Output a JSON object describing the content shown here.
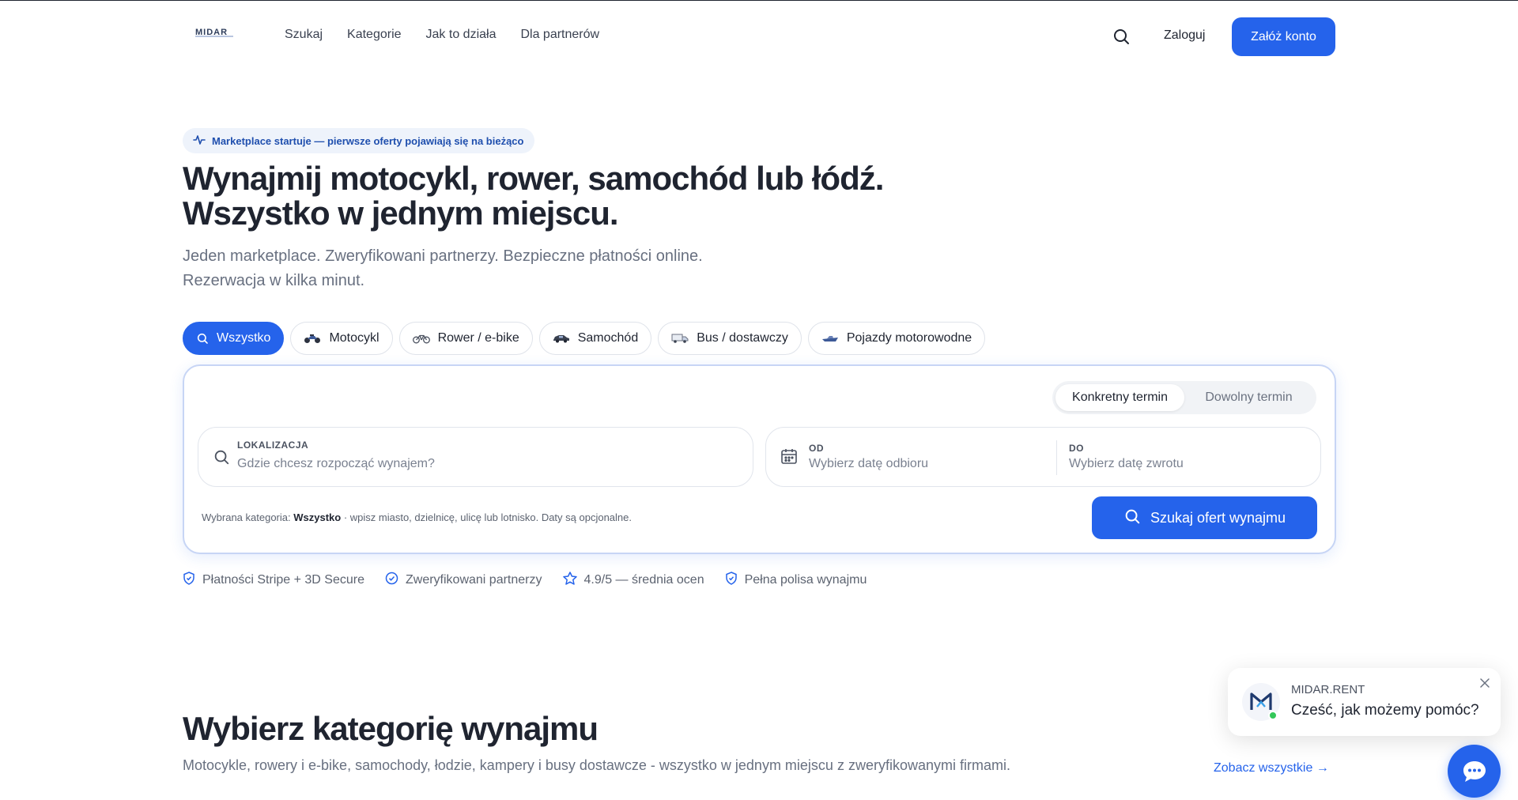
{
  "nav": {
    "logo_text": "MIDAR",
    "links": [
      "Szukaj",
      "Kategorie",
      "Jak to działa",
      "Dla partnerów"
    ],
    "login_label": "Zaloguj",
    "signup_label": "Załóż konto"
  },
  "hero": {
    "badge_text": "Marketplace startuje — pierwsze oferty pojawiają się na bieżąco",
    "title_line1": "Wynajmij motocykl, rower, samochód lub łódź.",
    "title_line2": "Wszystko w jednym miejscu.",
    "subtitle_line1": "Jeden marketplace. Zweryfikowani partnerzy. Bezpieczne płatności online.",
    "subtitle_line2": "Rezerwacja w kilka minut."
  },
  "categories": [
    {
      "label": "Wszystko",
      "icon": "search-icon",
      "active": true
    },
    {
      "label": "Motocykl",
      "icon": "motorcycle-icon",
      "active": false
    },
    {
      "label": "Rower / e-bike",
      "icon": "bicycle-icon",
      "active": false
    },
    {
      "label": "Samochód",
      "icon": "car-icon",
      "active": false
    },
    {
      "label": "Bus / dostawczy",
      "icon": "van-icon",
      "active": false
    },
    {
      "label": "Pojazdy motorowodne",
      "icon": "boat-icon",
      "active": false
    }
  ],
  "search": {
    "mode_specific": "Konkretny termin",
    "mode_any": "Dowolny termin",
    "location_label": "LOKALIZACJA",
    "location_placeholder": "Gdzie chcesz rozpocząć wynajem?",
    "from_label": "OD",
    "from_placeholder": "Wybierz datę odbioru",
    "to_label": "DO",
    "to_placeholder": "Wybierz datę zwrotu",
    "hint_prefix": "Wybrana kategoria:",
    "hint_category": "Wszystko",
    "hint_suffix": "· wpisz miasto, dzielnicę, ulicę lub lotnisko. Daty są opcjonalne.",
    "button_label": "Szukaj ofert wynajmu"
  },
  "trust": [
    "Płatności Stripe + 3D Secure",
    "Zweryfikowani partnerzy",
    "4.9/5 — średnia ocen",
    "Pełna polisa wynajmu"
  ],
  "section": {
    "title": "Wybierz kategorię wynajmu",
    "subtitle": "Motocykle, rowery i e-bike, samochody, łodzie, kampery i busy dostawcze - wszystko w jednym miejscu z zweryfikowanymi firmami.",
    "see_all": "Zobacz wszystkie →"
  },
  "chat": {
    "brand": "MIDAR.RENT",
    "message": "Cześć, jak możemy pomóc?"
  },
  "colors": {
    "accent": "#2563eb",
    "text": "#1f2430",
    "muted": "#687080",
    "online": "#34c759"
  }
}
